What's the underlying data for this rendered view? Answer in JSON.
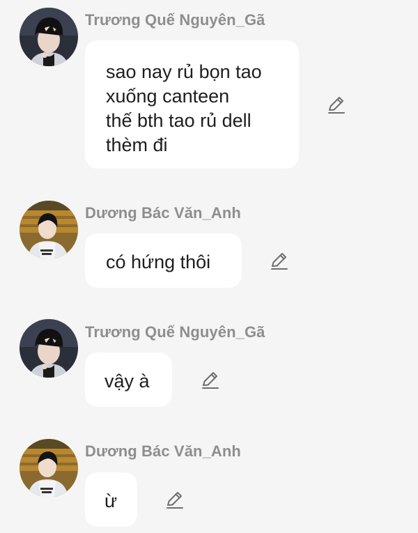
{
  "messages": [
    {
      "sender": "Trương Quế Nguyên_Gã",
      "avatar": "avatar-dark-hair-boy",
      "lines": [
        "sao nay rủ bọn tao",
        "xuống canteen",
        "thế bth tao rủ dell",
        "thèm đi"
      ],
      "edit_icon": "pencil-icon"
    },
    {
      "sender": "Dương Bác Văn_Anh",
      "avatar": "avatar-boy-stadium",
      "lines": [
        "có hứng thôi"
      ],
      "edit_icon": "pencil-icon"
    },
    {
      "sender": "Trương Quế Nguyên_Gã",
      "avatar": "avatar-dark-hair-boy",
      "lines": [
        "vậy à"
      ],
      "edit_icon": "pencil-icon"
    },
    {
      "sender": "Dương Bác Văn_Anh",
      "avatar": "avatar-boy-stadium",
      "lines": [
        "ừ"
      ],
      "edit_icon": "pencil-icon"
    }
  ],
  "colors": {
    "background": "#f5f5f5",
    "bubble": "#ffffff",
    "sender_text": "#8e8e8e",
    "message_text": "#1e1e1e"
  }
}
